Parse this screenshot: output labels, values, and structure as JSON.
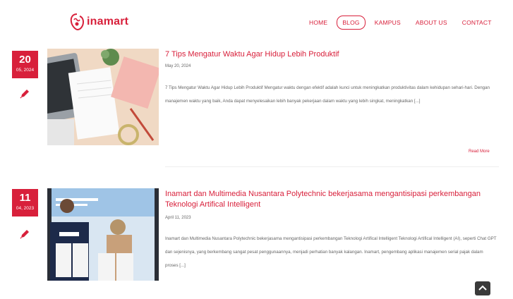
{
  "brand": {
    "logo_text": "inamart"
  },
  "nav": {
    "items": [
      {
        "label": "HOME"
      },
      {
        "label": "BLOG"
      },
      {
        "label": "KAMPUS"
      },
      {
        "label": "ABOUT US"
      },
      {
        "label": "CONTACT"
      }
    ],
    "active_index": 1
  },
  "posts": [
    {
      "day": "20",
      "month_year": "05, 2024",
      "title": "7 Tips Mengatur Waktu Agar Hidup Lebih Produktif",
      "date": "May 20, 2024",
      "excerpt": "7 Tips Mengatur Waktu Agar Hidup Lebih Produktif Mengatur waktu dengan efektif adalah kunci untuk meningkatkan produktivitas dalam kehidupan sehari-hari. Dengan manajemen waktu yang baik, Anda dapat menyelesaikan lebih banyak pekerjaan dalam waktu yang lebih singkat, meningkatkan [...]",
      "read_more": "Read More"
    },
    {
      "day": "11",
      "month_year": "04, 2023",
      "title": "Inamart dan Multimedia Nusantara Polytechnic bekerjasama mengantisipasi perkembangan Teknologi Artifical Intelligent",
      "date": "April 11, 2023",
      "excerpt": "Inamart dan Multimedia Nusantara Polytechnic bekerjasama mengantisipasi perkembangan Teknologi Artifical Intelligent Teknologi Artifical Intelligent (AI), seperti Chat GPT dan sejenisnya, yang berkembang sangat pesat penggunaannya, menjadi perhatian banyak kalangan. Inamart, pengembang aplikasi manajemen serial pajak dalam proses [...]"
    }
  ],
  "colors": {
    "accent": "#d8203b",
    "text": "#666666"
  },
  "icons": {
    "edit": "pencil-icon",
    "scroll": "chevron-up-icon"
  }
}
